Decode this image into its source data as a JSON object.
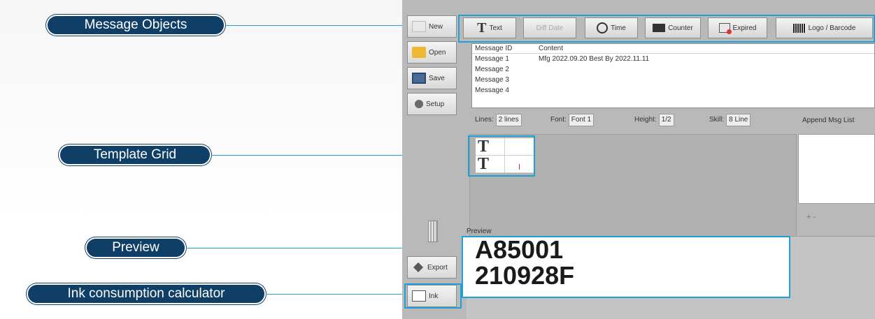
{
  "callouts": {
    "message_objects": "Message Objects",
    "template_grid": "Template Grid",
    "preview": "Preview",
    "ink_calculator": "Ink consumption calculator"
  },
  "sidebar": {
    "new_label": "New",
    "open_label": "Open",
    "save_label": "Save",
    "setup_label": "Setup",
    "export_label": "Export",
    "ink_label": "Ink"
  },
  "toolbar": {
    "text_label": "Text",
    "diff_date_label": "Diff Date",
    "time_label": "Time",
    "counter_label": "Counter",
    "expired_label": "Expired",
    "logo_barcode_label": "Logo / Barcode"
  },
  "message_table": {
    "headers": {
      "id": "Message ID",
      "content": "Content"
    },
    "rows": [
      {
        "id": "Message 1",
        "content": "Mfg 2022.09.20  Best By  2022.11.11"
      },
      {
        "id": "Message 2",
        "content": ""
      },
      {
        "id": "Message 3",
        "content": ""
      },
      {
        "id": "Message 4",
        "content": ""
      }
    ]
  },
  "options": {
    "lines_label": "Lines:",
    "lines_value": "2 lines",
    "font_label": "Font:",
    "font_value": "Font 1",
    "height_label": "Height:",
    "height_value": "1/2",
    "skill_label": "Skill:",
    "skill_value": "8 Line",
    "append_label": "Append Msg List"
  },
  "template_grid": {
    "cells": [
      "T",
      "",
      "T",
      ""
    ]
  },
  "append_controls": "+  -",
  "preview": {
    "label": "Preview",
    "lines": [
      "A85001",
      "210928F"
    ]
  },
  "colors": {
    "callout_bg": "#0f3e66",
    "leader": "#1ea0d8",
    "window_bg": "#b9b9b9"
  }
}
